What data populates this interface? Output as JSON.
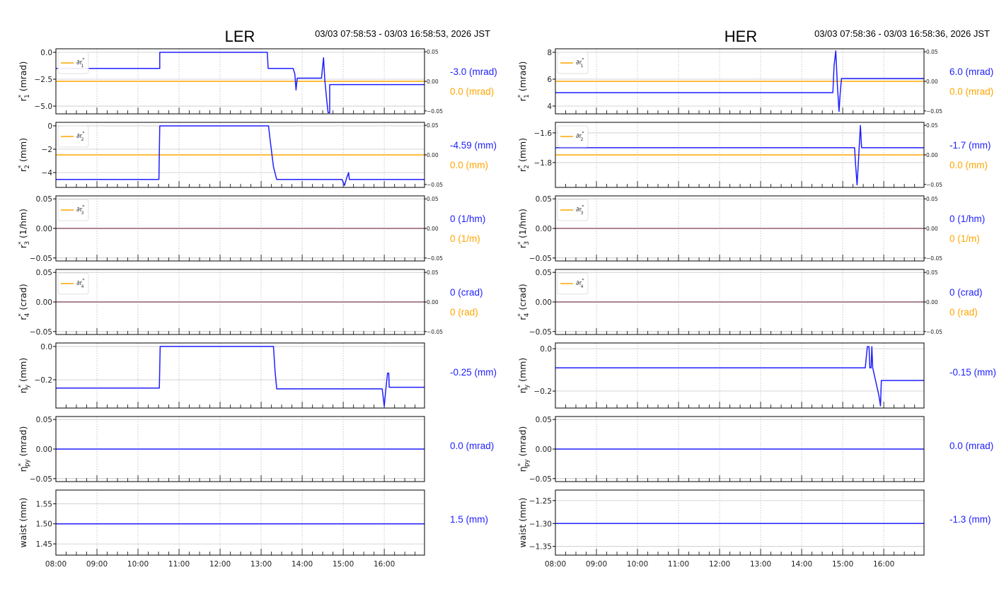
{
  "colors": {
    "blue": "#1f1fff",
    "orange": "#ffa500",
    "grid": "#c8c8c8"
  },
  "chart_data": [
    {
      "type": "line",
      "title": "LER",
      "time_range": "03/03 07:58:53 - 03/03 16:58:53, 2026 JST",
      "xlim": [
        8.0,
        16.98
      ],
      "xticks": [
        8,
        9,
        10,
        11,
        12,
        13,
        14,
        15,
        16
      ],
      "xticklabels": [
        "08:00",
        "09:00",
        "10:00",
        "11:00",
        "12:00",
        "13:00",
        "14:00",
        "15:00",
        "16:00"
      ],
      "panels": [
        {
          "ylabel": {
            "sym": "r",
            "sub": "1",
            "sup": "*",
            "unit": "(mrad)"
          },
          "ylim": [
            -5.72,
            0.33
          ],
          "yticks": [
            0.0,
            -2.5,
            -5.0
          ],
          "yticklabels": [
            "0.0",
            "−2.5",
            "−5.0"
          ],
          "series": [
            [
              8,
              -1.5
            ],
            [
              10.53,
              -1.5
            ],
            [
              10.53,
              0
            ],
            [
              13.15,
              0
            ],
            [
              13.17,
              -1.5
            ],
            [
              13.78,
              -1.5
            ],
            [
              13.82,
              -2.0
            ],
            [
              13.85,
              -3.5
            ],
            [
              13.88,
              -2.4
            ],
            [
              14.47,
              -2.4
            ],
            [
              14.52,
              -0.5
            ],
            [
              14.55,
              -2.5
            ],
            [
              14.6,
              -4.5
            ],
            [
              14.63,
              -5.6
            ],
            [
              14.67,
              -5.6
            ],
            [
              14.67,
              -3.0
            ],
            [
              16.98,
              -3.0
            ]
          ],
          "legend": {
            "sym": "∂r",
            "sub": "1",
            "sup": "*"
          },
          "right_axis": {
            "ylim": [
              -0.055,
              0.055
            ],
            "ticks": [
              "0.05",
              "0.00",
              "−0.05"
            ],
            "series_value": 0.0
          },
          "values": [
            {
              "text": "-3.0 (mrad)",
              "color": "blue"
            },
            {
              "text": "0.0 (mrad)",
              "color": "orange"
            }
          ]
        },
        {
          "ylabel": {
            "sym": "r",
            "sub": "2",
            "sup": "*",
            "unit": "(mm)"
          },
          "ylim": [
            -5.27,
            0.3
          ],
          "yticks": [
            0,
            -2,
            -4
          ],
          "yticklabels": [
            "0",
            "−2",
            "−4"
          ],
          "series": [
            [
              8,
              -4.59
            ],
            [
              10.51,
              -4.59
            ],
            [
              10.53,
              0
            ],
            [
              13.18,
              0
            ],
            [
              13.23,
              -1.5
            ],
            [
              13.3,
              -3.5
            ],
            [
              13.38,
              -4.59
            ],
            [
              14.97,
              -4.59
            ],
            [
              15.03,
              -5.1
            ],
            [
              15.08,
              -4.5
            ],
            [
              15.13,
              -4.0
            ],
            [
              15.15,
              -4.59
            ],
            [
              16.98,
              -4.59
            ]
          ],
          "legend": {
            "sym": "∂r",
            "sub": "2",
            "sup": "*"
          },
          "right_axis": {
            "ylim": [
              -0.055,
              0.055
            ],
            "ticks": [
              "0.05",
              "0.00",
              "−0.05"
            ],
            "series_value": 0.0
          },
          "values": [
            {
              "text": "-4.59 (mm)",
              "color": "blue"
            },
            {
              "text": "0.0 (mm)",
              "color": "orange"
            }
          ]
        },
        {
          "ylabel": {
            "sym": "r",
            "sub": "3",
            "sup": "*",
            "unit": "(1/hm)"
          },
          "ylim": [
            -0.055,
            0.055
          ],
          "yticks": [
            0.05,
            0,
            -0.05
          ],
          "yticklabels": [
            "0.05",
            "0.00",
            "−0.05"
          ],
          "series": [
            [
              8,
              0
            ],
            [
              16.98,
              0
            ]
          ],
          "legend": {
            "sym": "∂r",
            "sub": "3",
            "sup": "*"
          },
          "right_axis": {
            "ylim": [
              -0.055,
              0.055
            ],
            "ticks": [
              "0.05",
              "0.00",
              "−0.05"
            ],
            "series_value": 0.0
          },
          "values": [
            {
              "text": "0 (1/hm)",
              "color": "blue"
            },
            {
              "text": "0 (1/m)",
              "color": "orange"
            }
          ]
        },
        {
          "ylabel": {
            "sym": "r",
            "sub": "4",
            "sup": "*",
            "unit": "(crad)"
          },
          "ylim": [
            -0.055,
            0.055
          ],
          "yticks": [
            0.05,
            0,
            -0.05
          ],
          "yticklabels": [
            "0.05",
            "0.00",
            "−0.05"
          ],
          "series": [
            [
              8,
              0
            ],
            [
              16.98,
              0
            ]
          ],
          "legend": {
            "sym": "∂r",
            "sub": "4",
            "sup": "*"
          },
          "right_axis": {
            "ylim": [
              -0.055,
              0.055
            ],
            "ticks": [
              "0.05",
              "0.00",
              "−0.05"
            ],
            "series_value": 0.0
          },
          "values": [
            {
              "text": "0 (crad)",
              "color": "blue"
            },
            {
              "text": "0 (rad)",
              "color": "orange"
            }
          ]
        },
        {
          "ylabel": {
            "sym": "η",
            "sub": "y",
            "sup": "*",
            "unit": "(mm)"
          },
          "ylim": [
            -0.37,
            0.021
          ],
          "yticks": [
            0.0,
            -0.2
          ],
          "yticklabels": [
            "0.0",
            "−0.2"
          ],
          "series": [
            [
              8,
              -0.25
            ],
            [
              10.52,
              -0.25
            ],
            [
              10.54,
              0
            ],
            [
              13.3,
              0
            ],
            [
              13.34,
              -0.15
            ],
            [
              13.38,
              -0.255
            ],
            [
              15.95,
              -0.255
            ],
            [
              16.0,
              -0.36
            ],
            [
              16.04,
              -0.25
            ],
            [
              16.08,
              -0.16
            ],
            [
              16.11,
              -0.16
            ],
            [
              16.12,
              -0.245
            ],
            [
              16.98,
              -0.245
            ]
          ],
          "values": [
            {
              "text": "-0.25 (mm)",
              "color": "blue"
            }
          ]
        },
        {
          "ylabel": {
            "sym": "η",
            "sub": "py",
            "sup": "*",
            "unit": "(mrad)"
          },
          "ylim": [
            -0.055,
            0.055
          ],
          "yticks": [
            0.05,
            0,
            -0.05
          ],
          "yticklabels": [
            "0.05",
            "0.00",
            "−0.05"
          ],
          "series": [
            [
              8,
              0
            ],
            [
              16.98,
              0
            ]
          ],
          "values": [
            {
              "text": "0.0 (mrad)",
              "color": "blue"
            }
          ]
        },
        {
          "ylabel": {
            "sym": "waist",
            "sub": "",
            "sup": "",
            "unit": "(mm)"
          },
          "ylim": [
            1.422,
            1.584
          ],
          "yticks": [
            1.55,
            1.5,
            1.45
          ],
          "yticklabels": [
            "1.55",
            "1.50",
            "1.45"
          ],
          "series": [
            [
              8,
              1.5
            ],
            [
              16.98,
              1.5
            ]
          ],
          "values": [
            {
              "text": "1.5 (mm)",
              "color": "blue"
            }
          ]
        }
      ]
    },
    {
      "type": "line",
      "title": "HER",
      "time_range": "03/03 07:58:36 - 03/03 16:58:36, 2026 JST",
      "xlim": [
        8.0,
        16.98
      ],
      "xticks": [
        8,
        9,
        10,
        11,
        12,
        13,
        14,
        15,
        16
      ],
      "xticklabels": [
        "08:00",
        "09:00",
        "10:00",
        "11:00",
        "12:00",
        "13:00",
        "14:00",
        "15:00",
        "16:00"
      ],
      "panels": [
        {
          "ylabel": {
            "sym": "r",
            "sub": "1",
            "sup": "*",
            "unit": "(mrad)"
          },
          "ylim": [
            3.42,
            8.26
          ],
          "yticks": [
            8,
            6,
            4
          ],
          "yticklabels": [
            "8",
            "6",
            "4"
          ],
          "series": [
            [
              8,
              5.0
            ],
            [
              14.76,
              5.0
            ],
            [
              14.79,
              7.0
            ],
            [
              14.83,
              8.1
            ],
            [
              14.87,
              5.5
            ],
            [
              14.91,
              3.6
            ],
            [
              14.94,
              5.0
            ],
            [
              14.97,
              6.05
            ],
            [
              16.98,
              6.05
            ]
          ],
          "legend": {
            "sym": "∂r",
            "sub": "1",
            "sup": "*"
          },
          "right_axis": {
            "ylim": [
              -0.055,
              0.055
            ],
            "ticks": [
              "0.05",
              "0.00",
              "−0.05"
            ],
            "series_value": 0.0
          },
          "values": [
            {
              "text": "6.0 (mrad)",
              "color": "blue"
            },
            {
              "text": "0.0 (mrad)",
              "color": "orange"
            }
          ]
        },
        {
          "ylabel": {
            "sym": "r",
            "sub": "2",
            "sup": "*",
            "unit": "(mm)"
          },
          "ylim": [
            -1.967,
            -1.529
          ],
          "yticks": [
            -1.6,
            -1.8
          ],
          "yticklabels": [
            "−1.6",
            "−1.8"
          ],
          "series": [
            [
              8,
              -1.7
            ],
            [
              15.29,
              -1.7
            ],
            [
              15.31,
              -1.8
            ],
            [
              15.35,
              -1.95
            ],
            [
              15.39,
              -1.75
            ],
            [
              15.43,
              -1.55
            ],
            [
              15.46,
              -1.7
            ],
            [
              16.98,
              -1.7
            ]
          ],
          "legend": {
            "sym": "∂r",
            "sub": "2",
            "sup": "*"
          },
          "right_axis": {
            "ylim": [
              -0.055,
              0.055
            ],
            "ticks": [
              "0.05",
              "0.00",
              "−0.05"
            ],
            "series_value": 0.0
          },
          "values": [
            {
              "text": "-1.7 (mm)",
              "color": "blue"
            },
            {
              "text": "0.0 (mm)",
              "color": "orange"
            }
          ]
        },
        {
          "ylabel": {
            "sym": "r",
            "sub": "3",
            "sup": "*",
            "unit": "(1/hm)"
          },
          "ylim": [
            -0.055,
            0.055
          ],
          "yticks": [
            0.05,
            0,
            -0.05
          ],
          "yticklabels": [
            "0.05",
            "0.00",
            "−0.05"
          ],
          "series": [
            [
              8,
              0
            ],
            [
              16.98,
              0
            ]
          ],
          "legend": {
            "sym": "∂r",
            "sub": "3",
            "sup": "*"
          },
          "right_axis": {
            "ylim": [
              -0.055,
              0.055
            ],
            "ticks": [
              "0.05",
              "0.00",
              "−0.05"
            ],
            "series_value": 0.0
          },
          "values": [
            {
              "text": "0 (1/hm)",
              "color": "blue"
            },
            {
              "text": "0 (1/m)",
              "color": "orange"
            }
          ]
        },
        {
          "ylabel": {
            "sym": "r",
            "sub": "4",
            "sup": "*",
            "unit": "(crad)"
          },
          "ylim": [
            -0.055,
            0.055
          ],
          "yticks": [
            0.05,
            0,
            -0.05
          ],
          "yticklabels": [
            "0.05",
            "0.00",
            "−0.05"
          ],
          "series": [
            [
              8,
              0
            ],
            [
              16.98,
              0
            ]
          ],
          "legend": {
            "sym": "∂r",
            "sub": "4",
            "sup": "*"
          },
          "right_axis": {
            "ylim": [
              -0.055,
              0.055
            ],
            "ticks": [
              "0.05",
              "0.00",
              "−0.05"
            ],
            "series_value": 0.0
          },
          "values": [
            {
              "text": "0 (crad)",
              "color": "blue"
            },
            {
              "text": "0 (rad)",
              "color": "orange"
            }
          ]
        },
        {
          "ylabel": {
            "sym": "η",
            "sub": "y",
            "sup": "*",
            "unit": "(mm)"
          },
          "ylim": [
            -0.28,
            0.027
          ],
          "yticks": [
            0.0,
            -0.2
          ],
          "yticklabels": [
            "0.0",
            "−0.2"
          ],
          "series": [
            [
              8,
              -0.09
            ],
            [
              15.55,
              -0.09
            ],
            [
              15.6,
              0.01
            ],
            [
              15.64,
              0.01
            ],
            [
              15.66,
              -0.09
            ],
            [
              15.69,
              -0.09
            ],
            [
              15.71,
              0.01
            ],
            [
              15.73,
              -0.09
            ],
            [
              15.8,
              -0.15
            ],
            [
              15.88,
              -0.22
            ],
            [
              15.92,
              -0.27
            ],
            [
              15.94,
              -0.15
            ],
            [
              16.98,
              -0.15
            ]
          ],
          "values": [
            {
              "text": "-0.15 (mm)",
              "color": "blue"
            }
          ]
        },
        {
          "ylabel": {
            "sym": "η",
            "sub": "py",
            "sup": "*",
            "unit": "(mrad)"
          },
          "ylim": [
            -0.055,
            0.055
          ],
          "yticks": [
            0.05,
            0,
            -0.05
          ],
          "yticklabels": [
            "0.05",
            "0.00",
            "−0.05"
          ],
          "series": [
            [
              8,
              0
            ],
            [
              16.98,
              0
            ]
          ],
          "values": [
            {
              "text": "0.0 (mrad)",
              "color": "blue"
            }
          ]
        },
        {
          "ylabel": {
            "sym": "waist",
            "sub": "",
            "sup": "",
            "unit": "(mm)"
          },
          "ylim": [
            -1.369,
            -1.227
          ],
          "yticks": [
            -1.25,
            -1.3,
            -1.35
          ],
          "yticklabels": [
            "−1.25",
            "−1.30",
            "−1.35"
          ],
          "series": [
            [
              8,
              -1.3
            ],
            [
              16.98,
              -1.3
            ]
          ],
          "values": [
            {
              "text": "-1.3 (mm)",
              "color": "blue"
            }
          ]
        }
      ]
    }
  ]
}
